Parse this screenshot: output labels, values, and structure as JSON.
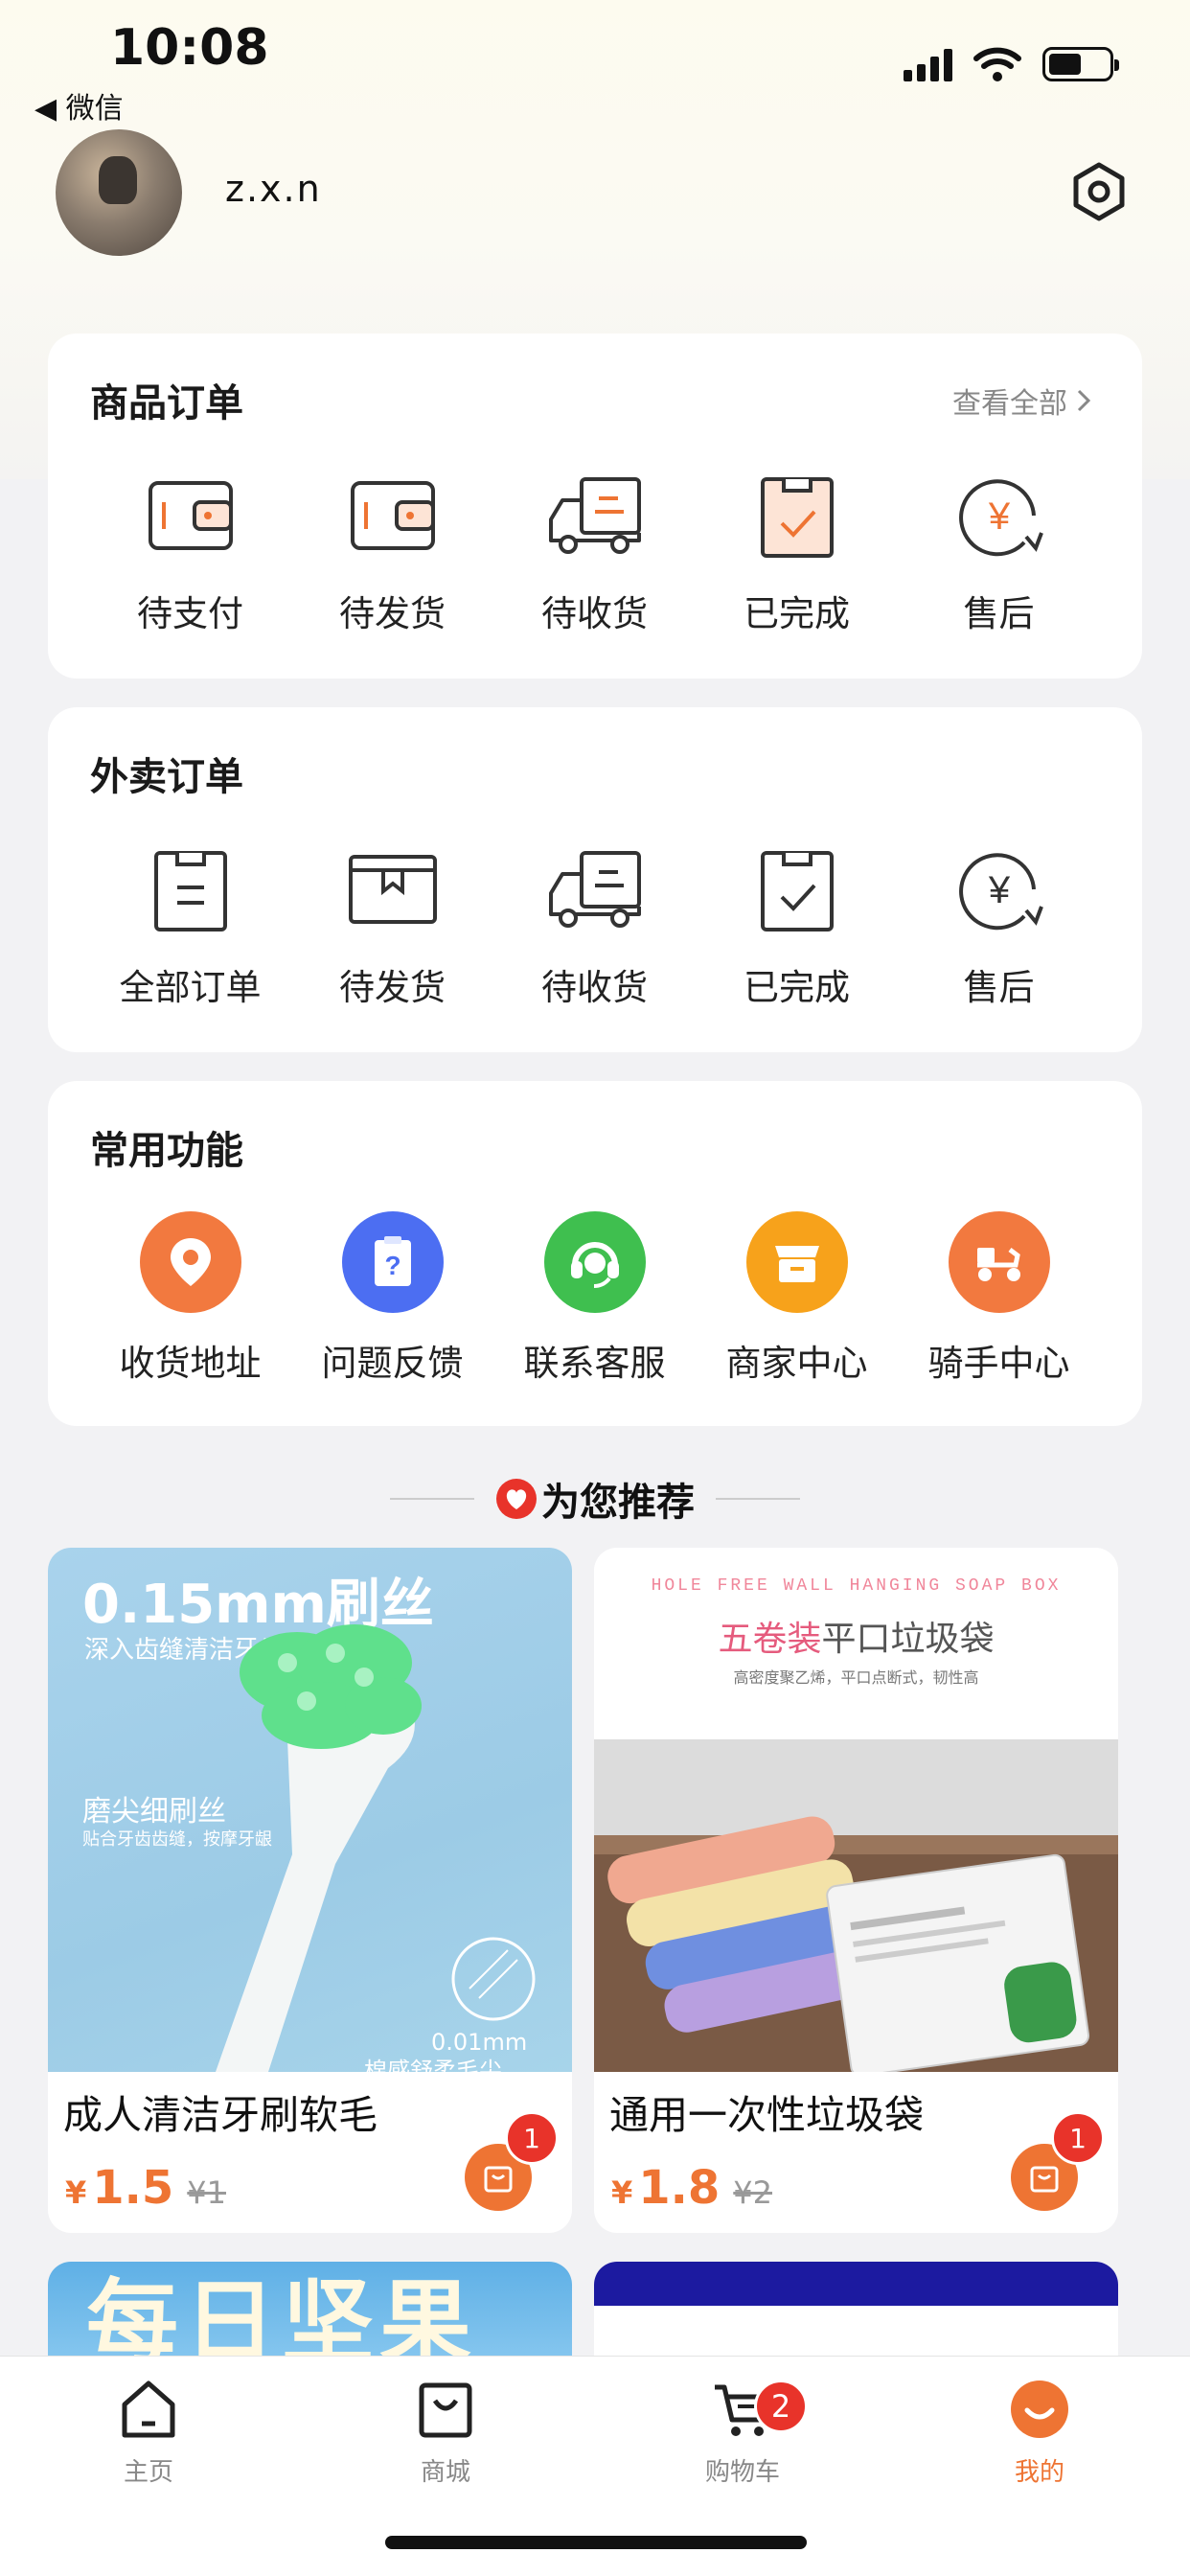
{
  "status_bar": {
    "time": "10:08",
    "back_label": "◀ 微信"
  },
  "profile": {
    "username": "z.x.n"
  },
  "goods_orders": {
    "title": "商品订单",
    "view_all": "查看全部",
    "items": [
      {
        "label": "待支付",
        "icon": "wallet-icon"
      },
      {
        "label": "待发货",
        "icon": "wallet-icon"
      },
      {
        "label": "待收货",
        "icon": "truck-icon"
      },
      {
        "label": "已完成",
        "icon": "clipboard-check-icon"
      },
      {
        "label": "售后",
        "icon": "yuan-refresh-icon"
      }
    ]
  },
  "takeout_orders": {
    "title": "外卖订单",
    "items": [
      {
        "label": "全部订单",
        "icon": "clipboard-list-icon"
      },
      {
        "label": "待发货",
        "icon": "box-icon"
      },
      {
        "label": "待收货",
        "icon": "truck-icon"
      },
      {
        "label": "已完成",
        "icon": "clipboard-check-icon"
      },
      {
        "label": "售后",
        "icon": "yuan-refresh-icon"
      }
    ]
  },
  "common_functions": {
    "title": "常用功能",
    "items": [
      {
        "label": "收货地址",
        "icon": "location-pin-icon",
        "color": "#f2793f"
      },
      {
        "label": "问题反馈",
        "icon": "question-clipboard-icon",
        "color": "#4c6ef2"
      },
      {
        "label": "联系客服",
        "icon": "headset-icon",
        "color": "#3fbf4f"
      },
      {
        "label": "商家中心",
        "icon": "store-icon",
        "color": "#f7a21b"
      },
      {
        "label": "骑手中心",
        "icon": "scooter-icon",
        "color": "#f2793f"
      }
    ]
  },
  "recommend": {
    "title": "为您推荐",
    "products": [
      {
        "name": "成人清洁牙刷软毛",
        "price_symbol": "¥",
        "price": "1.5",
        "old_price": "¥1",
        "cart_count": "1",
        "image": {
          "headline": "0.15mm刷丝",
          "sub": "深入齿缝清洁牙齿",
          "label1": "磨尖细刷丝",
          "label1_sub": "贴合牙齿齿缝，按摩牙龈",
          "label2": "0.01mm",
          "label3": "棉感舒柔毛尖"
        }
      },
      {
        "name": "通用一次性垃圾袋",
        "price_symbol": "¥",
        "price": "1.8",
        "old_price": "¥2",
        "cart_count": "1",
        "image": {
          "eng": "HOLE FREE WALL HANGING SOAP BOX",
          "headline_a": "五卷装",
          "headline_b": "平口垃圾袋",
          "sub": "高密度聚乙烯，平口点断式，韧性高"
        }
      }
    ],
    "partial_banner": "每日坚果"
  },
  "tabbar": {
    "tabs": [
      {
        "label": "主页",
        "icon": "home-icon"
      },
      {
        "label": "商城",
        "icon": "shopping-bag-icon"
      },
      {
        "label": "购物车",
        "icon": "cart-icon",
        "badge": "2"
      },
      {
        "label": "我的",
        "icon": "smile-icon",
        "active": true
      }
    ]
  },
  "colors": {
    "accent": "#ee7433",
    "badge": "#e8332a",
    "background": "#f2f2f4"
  }
}
